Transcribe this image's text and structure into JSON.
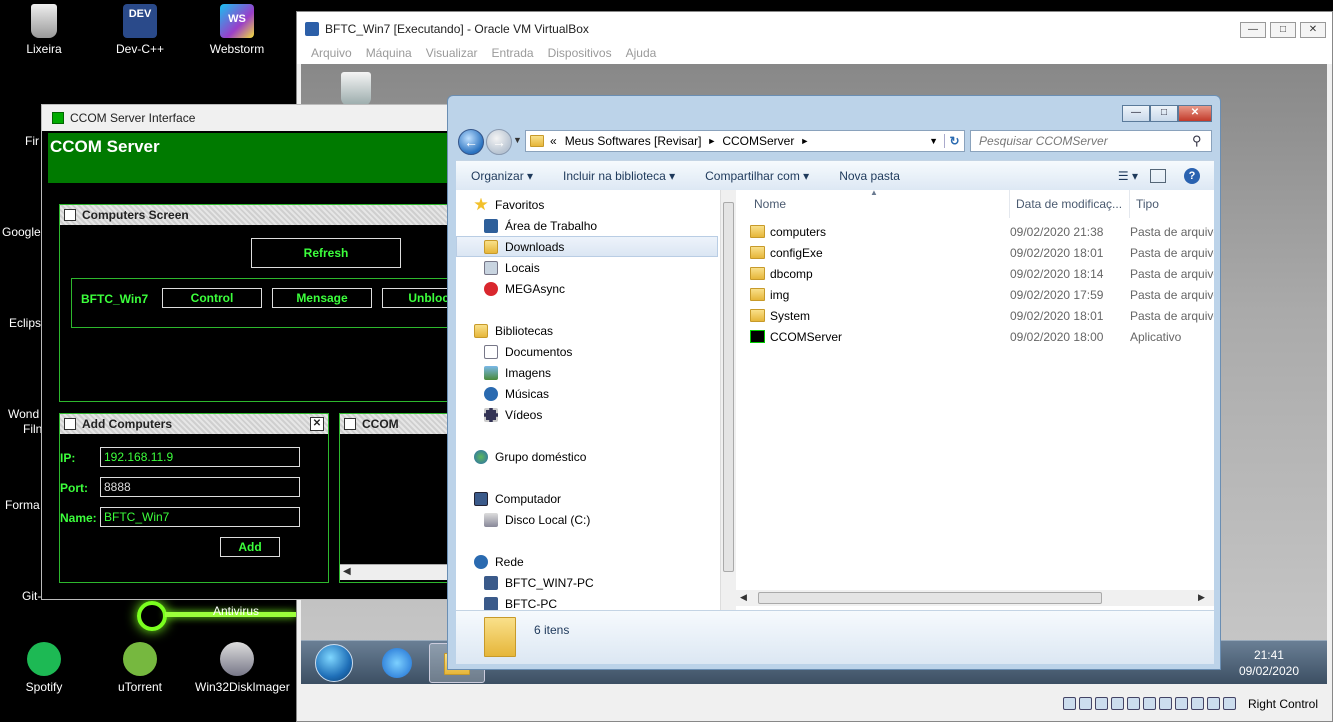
{
  "desktop": {
    "icons": [
      {
        "label": "Lixeira"
      },
      {
        "label": "Dev-C++"
      },
      {
        "label": "Webstorm"
      },
      {
        "label": "Spotify"
      },
      {
        "label": "uTorrent"
      },
      {
        "label": "Win32DiskImager"
      }
    ],
    "partial_labels": [
      "Fir",
      "Google",
      "Eclips",
      "Wond",
      "Filn",
      "Forma",
      "Git-"
    ],
    "antivirus_label": "Antivirus"
  },
  "vbox": {
    "title": "BFTC_Win7 [Executando] - Oracle VM VirtualBox",
    "menu": [
      "Arquivo",
      "Máquina",
      "Visualizar",
      "Entrada",
      "Dispositivos",
      "Ajuda"
    ],
    "host_key": "Right Control",
    "guest_clock": {
      "time": "21:41",
      "date": "09/02/2020"
    }
  },
  "ccom": {
    "window_title": "CCOM Server Interface",
    "banner": "CCOM Server",
    "computers_panel": {
      "title": "Computers Screen",
      "refresh": "Refresh",
      "row": {
        "name": "BFTC_Win7",
        "control": "Control",
        "message": "Mensage",
        "unblock": "Unblock"
      }
    },
    "add_panel": {
      "title": "Add Computers",
      "ip_label": "IP:",
      "ip_value": "192.168.11.9",
      "port_label": "Port:",
      "port_value": "8888",
      "name_label": "Name:",
      "name_value": "BFTC_Win7",
      "add": "Add"
    },
    "ccom_panel": {
      "title": "CCOM"
    }
  },
  "explorer": {
    "breadcrumb": [
      "Meus Softwares [Revisar]",
      "CCOMServer"
    ],
    "breadcrumb_prefix": "«",
    "search_placeholder": "Pesquisar CCOMServer",
    "toolbar": [
      "Organizar",
      "Incluir na biblioteca",
      "Compartilhar com",
      "Nova pasta"
    ],
    "nav": [
      {
        "label": "Favoritos",
        "indent": 0
      },
      {
        "label": "Área de Trabalho",
        "indent": 1
      },
      {
        "label": "Downloads",
        "indent": 1,
        "selected": true
      },
      {
        "label": "Locais",
        "indent": 1
      },
      {
        "label": "MEGAsync",
        "indent": 1
      },
      {
        "label": "Bibliotecas",
        "indent": 0
      },
      {
        "label": "Documentos",
        "indent": 1
      },
      {
        "label": "Imagens",
        "indent": 1
      },
      {
        "label": "Músicas",
        "indent": 1
      },
      {
        "label": "Vídeos",
        "indent": 1
      },
      {
        "label": "Grupo doméstico",
        "indent": 0
      },
      {
        "label": "Computador",
        "indent": 0
      },
      {
        "label": "Disco Local (C:)",
        "indent": 1
      },
      {
        "label": "Rede",
        "indent": 0
      },
      {
        "label": "BFTC_WIN7-PC",
        "indent": 1
      },
      {
        "label": "BFTC-PC",
        "indent": 1
      }
    ],
    "columns": {
      "name": "Nome",
      "date": "Data de modificaç...",
      "type": "Tipo"
    },
    "files": [
      {
        "name": "computers",
        "date": "09/02/2020 21:38",
        "type": "Pasta de arquivos",
        "kind": "folder"
      },
      {
        "name": "configExe",
        "date": "09/02/2020 18:01",
        "type": "Pasta de arquivos",
        "kind": "folder"
      },
      {
        "name": "dbcomp",
        "date": "09/02/2020 18:14",
        "type": "Pasta de arquivos",
        "kind": "folder"
      },
      {
        "name": "img",
        "date": "09/02/2020 17:59",
        "type": "Pasta de arquivos",
        "kind": "folder"
      },
      {
        "name": "System",
        "date": "09/02/2020 18:01",
        "type": "Pasta de arquivos",
        "kind": "folder"
      },
      {
        "name": "CCOMServer",
        "date": "09/02/2020 18:00",
        "type": "Aplicativo",
        "kind": "app"
      }
    ],
    "item_count": "6 itens"
  }
}
